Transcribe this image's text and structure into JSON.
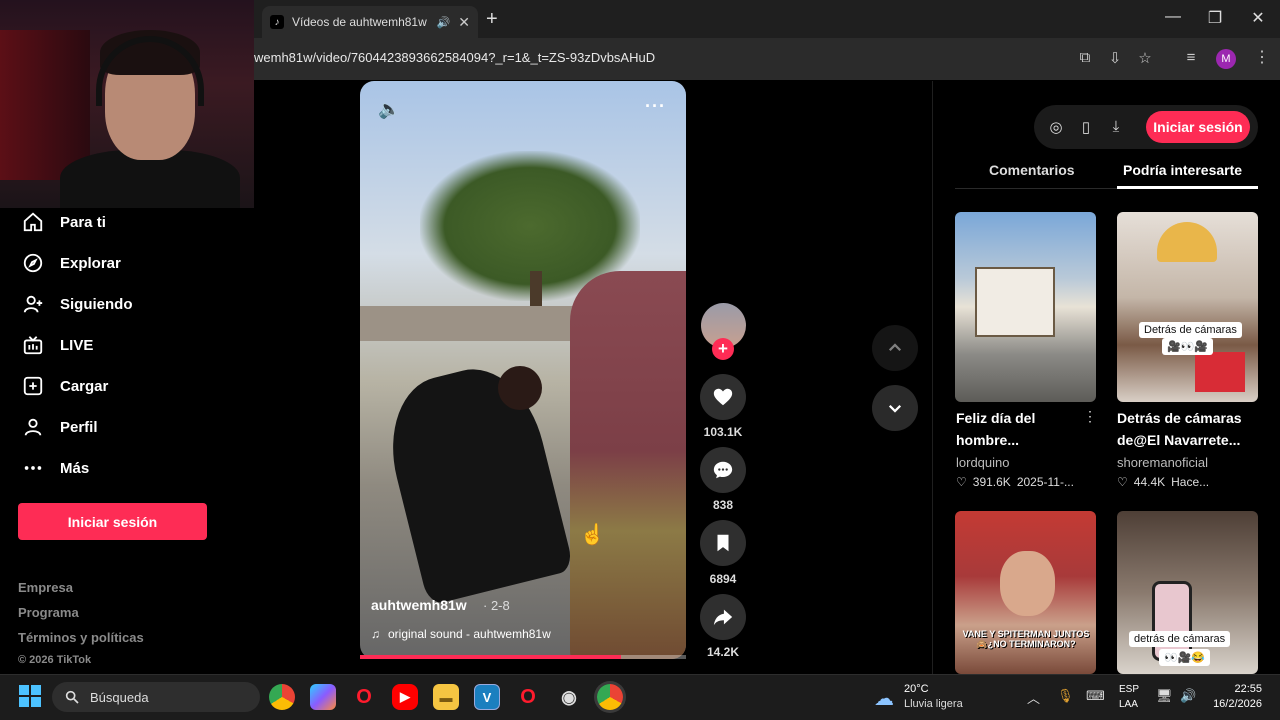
{
  "browser": {
    "tab_title": "Vídeos de auhtwemh81w (@auhtwemh81w)",
    "url": "wemh81w/video/7604423893662584094?_r=1&_t=ZS-93zDvbsAHuD",
    "profile_initial": "M",
    "new_tab": "+",
    "minimize": "—",
    "maximize": "❐",
    "close": "✕"
  },
  "sidebar": {
    "items": [
      {
        "label": "Para ti",
        "icon": "home-icon"
      },
      {
        "label": "Explorar",
        "icon": "compass-icon"
      },
      {
        "label": "Siguiendo",
        "icon": "user-follow-icon"
      },
      {
        "label": "LIVE",
        "icon": "live-tv-icon"
      },
      {
        "label": "Cargar",
        "icon": "upload-plus-icon"
      },
      {
        "label": "Perfil",
        "icon": "profile-icon"
      },
      {
        "label": "Más",
        "icon": "more-dots-icon"
      }
    ],
    "login_button": "Iniciar sesión",
    "footer": [
      "Empresa",
      "Programa",
      "Términos y políticas"
    ],
    "copyright": "© 2026 TikTok"
  },
  "video": {
    "author": "auhtwemh81w",
    "date": "· 2-8",
    "sound": "original sound - auhtwemh81w",
    "progress": 0.8
  },
  "actions": {
    "likes": "103.1K",
    "comments": "838",
    "saves": "6894",
    "shares": "14.2K"
  },
  "right": {
    "login_button": "Iniciar sesión",
    "tabs": [
      "Comentarios",
      "Podría interesarte"
    ],
    "cards": [
      {
        "title_line1": "Feliz día del",
        "title_line2": "hombre...",
        "author": "lordquino",
        "likes": "391.6K",
        "date": "2025-11-..."
      },
      {
        "title_line1": "Detrás de cámaras",
        "title_line2": "de@El Navarrete...",
        "author": "shoremanoficial",
        "likes": "44.4K",
        "date": "Hace...",
        "overlay": "Detrás de cámaras",
        "overlay2": "🎥👀🎥"
      },
      {
        "overlay": "VANE Y SPITERMAN JUNTOS 🙈¿NO TERMINARON?"
      },
      {
        "overlay": "detrás de cámaras",
        "overlay2": "👀🎥😂"
      }
    ]
  },
  "taskbar": {
    "search_placeholder": "Búsqueda",
    "weather_temp": "20°C",
    "weather_desc": "Lluvia ligera",
    "lang1": "ESP",
    "lang2": "LAA",
    "time": "22:55",
    "date": "16/2/2026"
  },
  "colors": {
    "accent": "#fe2c55",
    "background": "#000000",
    "browser_chrome": "#2b2b2b"
  }
}
